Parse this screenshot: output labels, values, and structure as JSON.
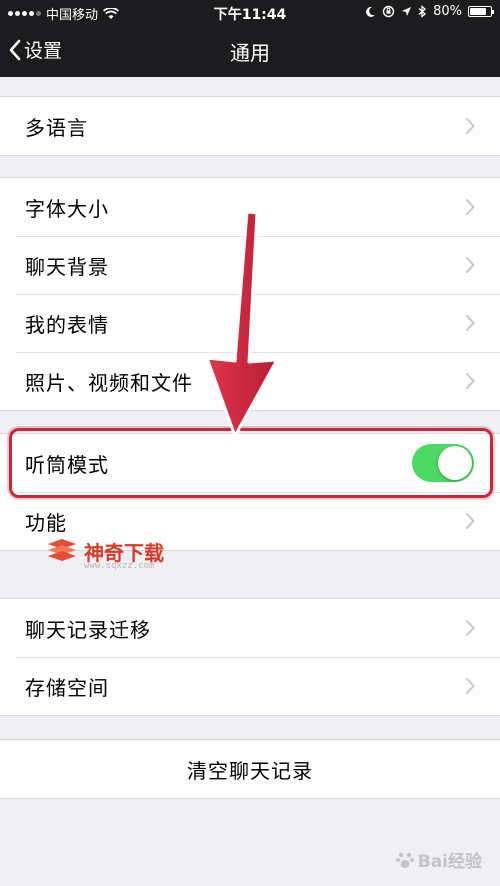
{
  "status_bar": {
    "carrier": "中国移动",
    "time": "下午11:44",
    "battery": "80%",
    "battery_level": 0.8,
    "icons": [
      "signal-icon",
      "wifi-icon",
      "moon-icon",
      "orientation-lock-icon",
      "location-icon",
      "bluetooth-icon",
      "battery-icon"
    ]
  },
  "nav": {
    "back_label": "设置",
    "title": "通用"
  },
  "sections": {
    "language": {
      "label": "多语言"
    },
    "display": {
      "font_size": "字体大小",
      "chat_background": "聊天背景",
      "my_stickers": "我的表情",
      "media_files": "照片、视频和文件"
    },
    "earpiece": {
      "label": "听筒模式",
      "enabled": true
    },
    "features": {
      "label": "功能"
    },
    "storage": {
      "migrate": "聊天记录迁移",
      "storage_space": "存储空间"
    },
    "clear": {
      "label": "清空聊天记录"
    }
  },
  "watermark": {
    "brand": "神奇下载",
    "url": "www.sqxzz.com"
  },
  "footer_watermark": {
    "text": "Bai经验"
  },
  "colors": {
    "nav_background": "#1c1c1e",
    "page_background": "#efeff4",
    "switch_on": "#4cd964",
    "highlight": "#c8283e",
    "watermark": "#d93a2b"
  }
}
